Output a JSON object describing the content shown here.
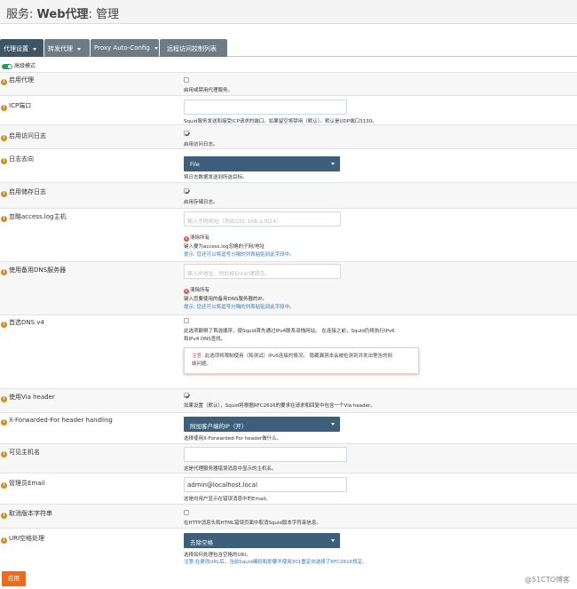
{
  "header": {
    "service": "服务:",
    "name": "Web代理",
    "sep": ":",
    "page": "管理"
  },
  "tabs": [
    {
      "label": "代理设置",
      "dropdown": true
    },
    {
      "label": "转发代理",
      "dropdown": true
    },
    {
      "label": "Proxy Auto-Config",
      "dropdown": true
    },
    {
      "label": "远程访问控制列表",
      "dropdown": false
    }
  ],
  "advanced_mode": "高级模式",
  "rows": {
    "enable_proxy": {
      "label": "启用代理",
      "checked": false,
      "help": "启用或禁用代理服务。"
    },
    "icp_port": {
      "label": "ICP端口",
      "value": "",
      "help": "Squid服务发送和接受ICP请求的端口。如果留空将禁用（默认）。默认是UDP端口3130。"
    },
    "access_log": {
      "label": "启用访问日志",
      "checked": true,
      "help": "启用访问日志。"
    },
    "log_target": {
      "label": "日志去向",
      "selected": "File",
      "help": "将日志数据发送到所选目标。"
    },
    "store_log": {
      "label": "启用储存日志",
      "checked": true,
      "help": "启用存储日志。"
    },
    "ignore_hosts": {
      "label": "忽略access.log主机",
      "placeholder": "输入子网地址（例如192.168.2.0/24）",
      "clear": "清除所有",
      "help": "键入要为access.log忽略的子网/地址",
      "tip": "提示: 您还可以将逗号分隔的列表粘贴到此字段中。"
    },
    "dns_servers": {
      "label": "使用备用DNS服务器",
      "placeholder": "输入IP地址，然后按Enter键提交。",
      "clear": "清除所有",
      "help": "键入您要使用的备用DNS服务器的IP。",
      "tip": "提示: 您还可以将逗号分隔的列表粘贴到此字段中。"
    },
    "prefer_dns4": {
      "label": "首选DNS v4",
      "checked": false,
      "help1": "此选项颠倒了首选顺序，使Squid首先通过IPv4联系双栈网站。 在连接之前，Squid仍将执行IPv6",
      "help2": "和IPv4 DNS查找。",
      "note_prefix": "注意:",
      "note1": " 此选项将限制使用（和测试）IPv6连接的情况。 隐藏漏洞本会被检测到并发出警告的网",
      "note2": "络问题。"
    },
    "via_header": {
      "label": "使用Via header",
      "checked": true,
      "help": "如果设置（默认），Squid将根据RFC2616的要求在请求和回复中包含一个Via header。"
    },
    "xff": {
      "label": "X-Forwarded-For header handling",
      "selected": "附加客户端的IP（开）",
      "help": "选择使用X-Forwarded-For header做什么。"
    },
    "visible_hostname": {
      "label": "可见主机名",
      "value": "",
      "help": "这是代理服务器错误消息中显示的主机名。"
    },
    "admin_email": {
      "label": "管理员Email",
      "value": "admin@localhost.local",
      "help": "这是向用户显示在错误消息中的Email。"
    },
    "suppress_version": {
      "label": "取消版本字符串",
      "checked": false,
      "help": "在HTTP消息头和HTML错误页面中取消Squid版本字符串信息。"
    },
    "uri_whitespace": {
      "label": "URI空格处理",
      "selected": "去除空格",
      "help": "选择如何处理包含空格的URI。",
      "note": "注意:在更改URL后，当前Squid编码和即要不使用301重定向选择了RFC2616规定。"
    }
  },
  "apply_label": "应用",
  "watermark": "@51CTO博客"
}
